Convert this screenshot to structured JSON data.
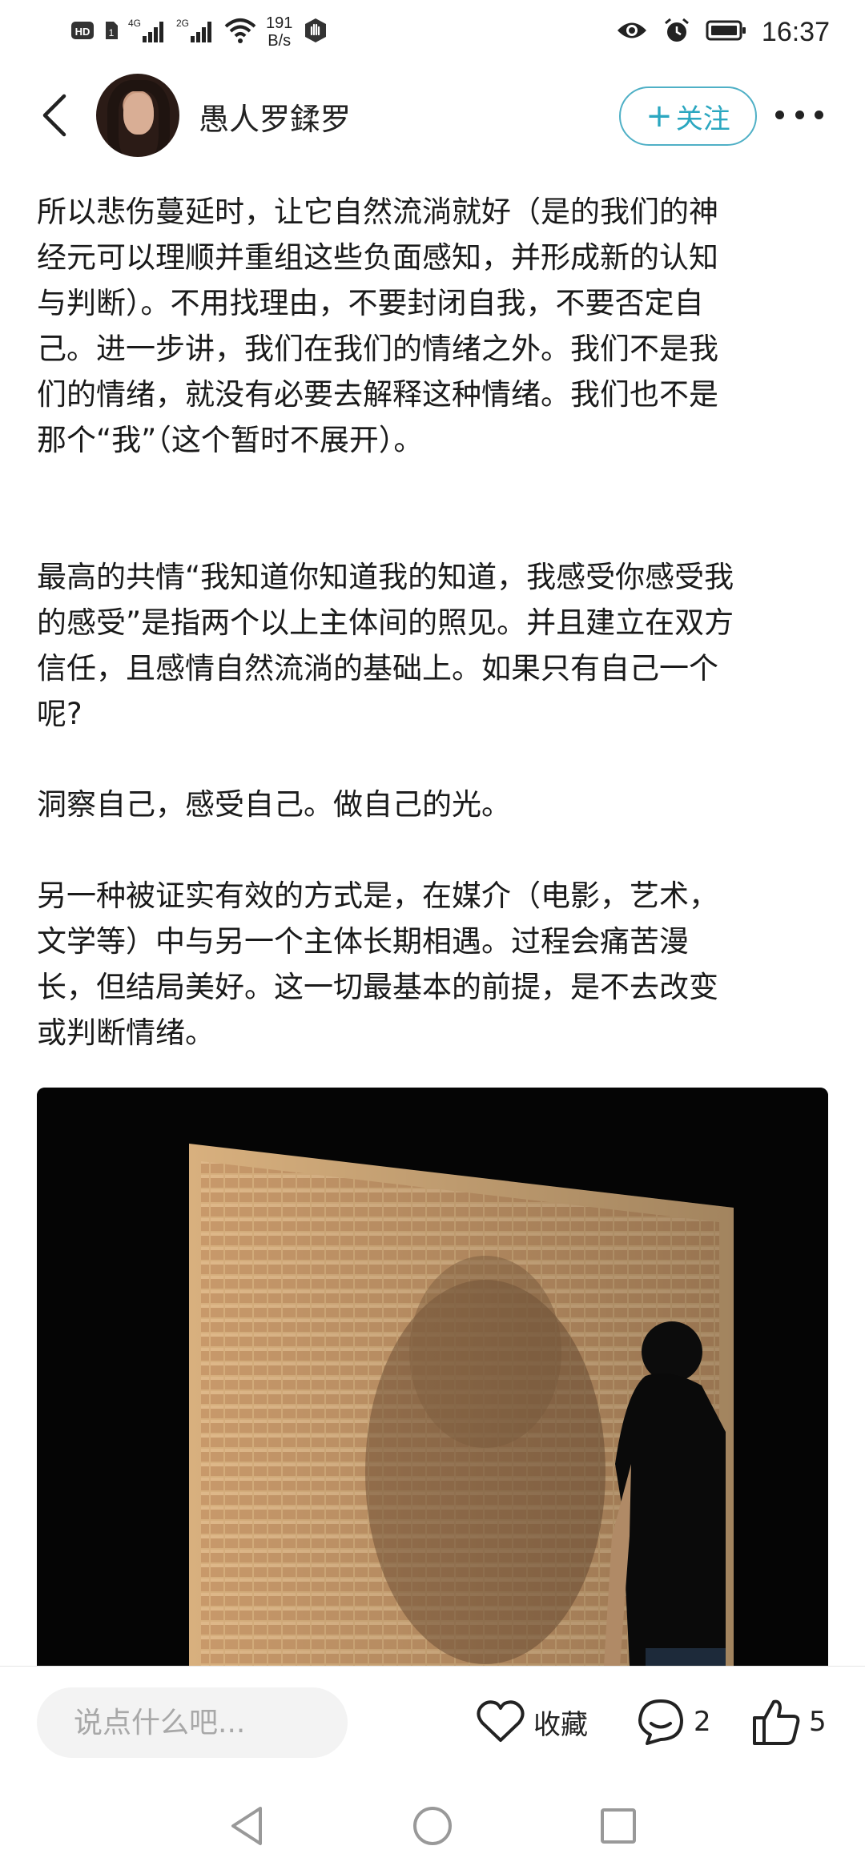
{
  "status_bar": {
    "left_badges": [
      "HD",
      "4G",
      "2G"
    ],
    "net_speed_value": "191",
    "net_speed_unit": "B/s",
    "time": "16:37",
    "icons": [
      "hd-icon",
      "sim-icon",
      "signal-4g-icon",
      "signal-2g-icon",
      "wifi-icon",
      "hand-icon",
      "eye-icon",
      "alarm-icon",
      "battery-icon"
    ]
  },
  "header": {
    "author_name": "愚人罗鍒罗",
    "follow_plus": "+",
    "follow_label": "关注"
  },
  "article": {
    "paragraphs": [
      [
        "所以悲伤蔓延时，让它自然流淌就好（是的我们的神",
        "经元可以理顺并重组这些负面感知，并形成新的认知",
        "与判断）。不用找理由，不要封闭自我，不要否定自",
        "己。进一步讲，我们在我们的情绪之外。我们不是我",
        "们的情绪，就没有必要去解释这种情绪。我们也不是",
        "那个“我”（这个暂时不展开）。"
      ],
      [
        "最高的共情“我知道你知道我的知道，我感受你感受我",
        "的感受”是指两个以上主体间的照见。并且建立在双方",
        "信任，且感情自然流淌的基础上。如果只有自己一个",
        "呢?"
      ],
      [
        "洞察自己，感受自己。做自己的光。"
      ],
      [
        "另一种被证实有效的方式是，在媒介（电影，艺术，",
        "文学等）中与另一个主体长期相遇。过程会痛苦漫",
        "长，但结局美好。这一切最基本的前提，是不去改变",
        "或判断情绪。"
      ]
    ]
  },
  "bottom_bar": {
    "comment_placeholder": "说点什么吧...",
    "favorite_label": "收藏",
    "comment_count": "2",
    "like_count": "5"
  },
  "colors": {
    "accent": "#2ba7c0",
    "text": "#1a1a1a",
    "input_bg": "#f3f3f3"
  }
}
